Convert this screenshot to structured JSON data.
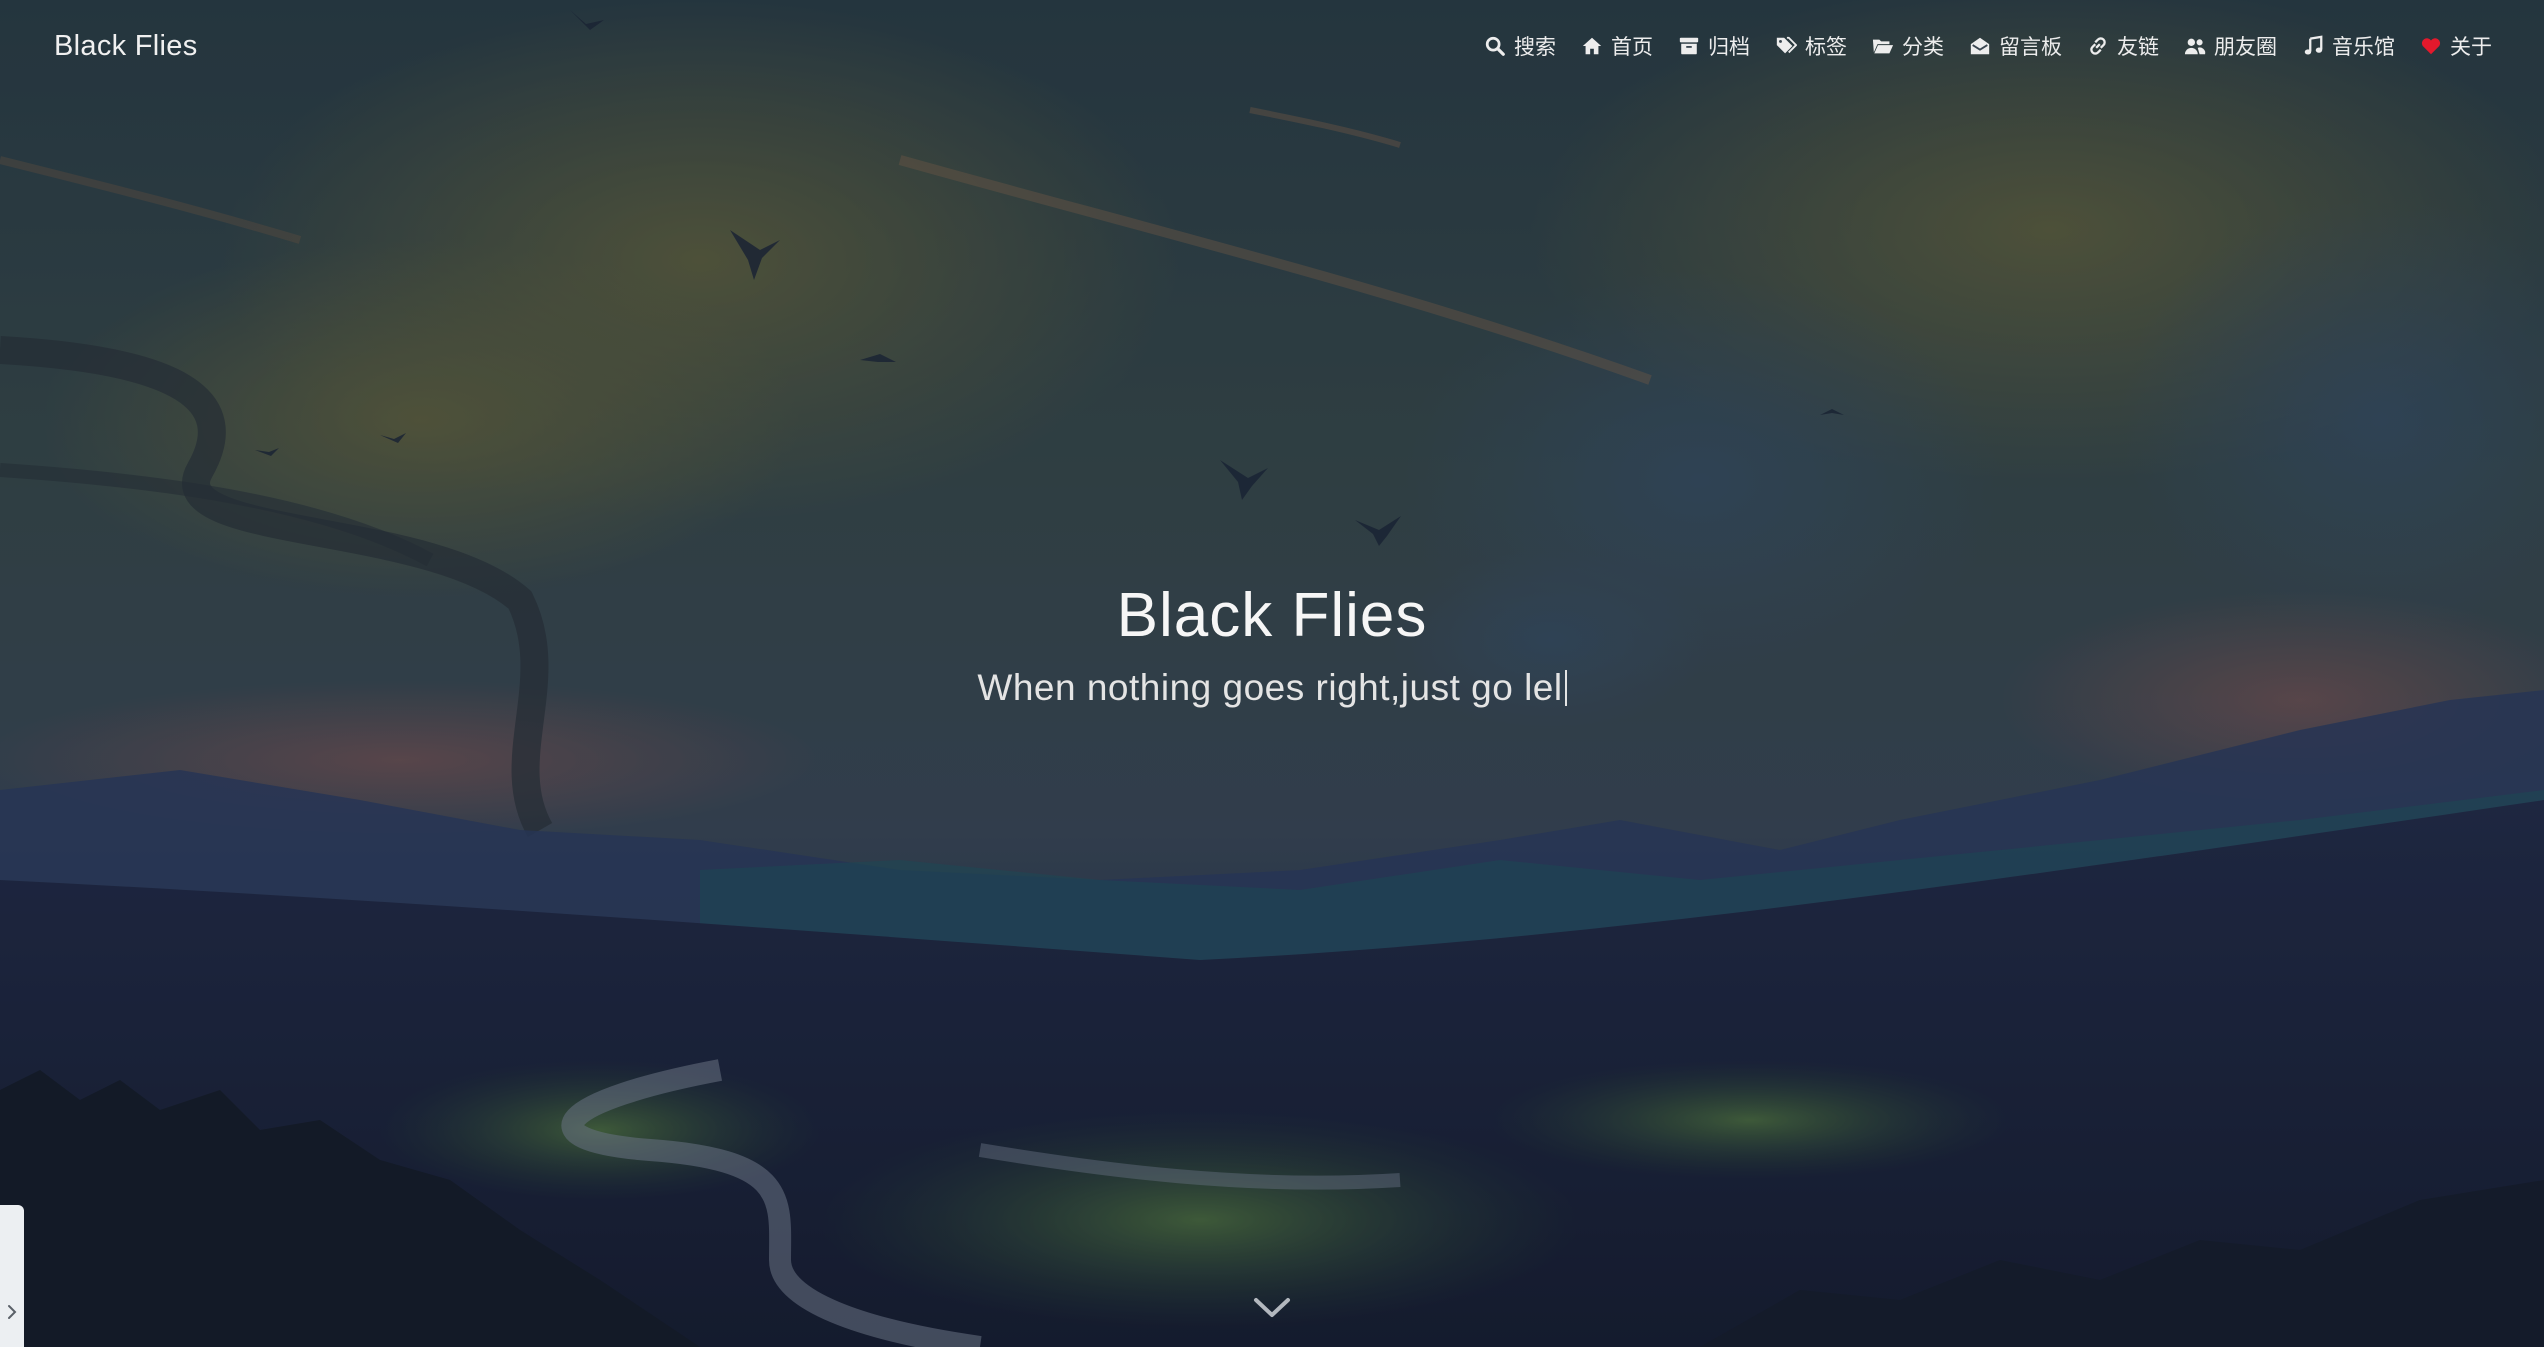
{
  "navbar": {
    "brand": "Black Flies",
    "items": [
      {
        "label": "搜索",
        "icon": "search-icon"
      },
      {
        "label": "首页",
        "icon": "home-icon"
      },
      {
        "label": "归档",
        "icon": "archive-icon"
      },
      {
        "label": "标签",
        "icon": "tags-icon"
      },
      {
        "label": "分类",
        "icon": "folder-open-icon"
      },
      {
        "label": "留言板",
        "icon": "envelope-open-icon"
      },
      {
        "label": "友链",
        "icon": "link-icon"
      },
      {
        "label": "朋友圈",
        "icon": "users-icon"
      },
      {
        "label": "音乐馆",
        "icon": "music-icon"
      },
      {
        "label": "关于",
        "icon": "heart-icon"
      }
    ]
  },
  "hero": {
    "title": "Black Flies",
    "subtitle": "When nothing goes right,just go lel"
  },
  "colors": {
    "heart": "#e3192c",
    "text": "#f2f2f2"
  }
}
